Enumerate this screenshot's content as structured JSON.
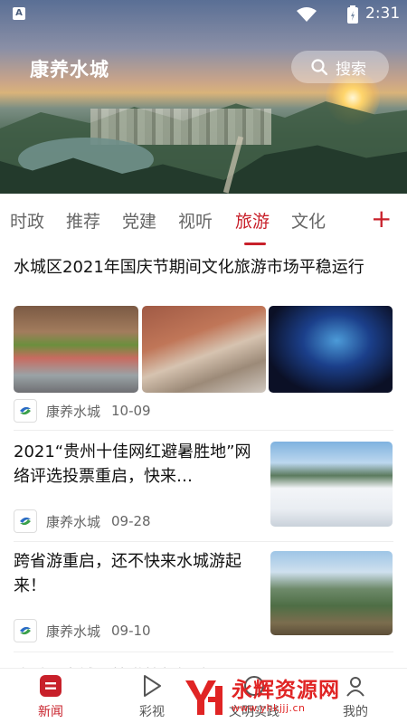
{
  "status_bar": {
    "time": "2:31",
    "left_icon": "A"
  },
  "header": {
    "app_title": "康养水城",
    "search_label": "搜索"
  },
  "tabs": [
    {
      "label": "时政",
      "active": false
    },
    {
      "label": "推荐",
      "active": false
    },
    {
      "label": "党建",
      "active": false
    },
    {
      "label": "视听",
      "active": false
    },
    {
      "label": "旅游",
      "active": true
    },
    {
      "label": "文化",
      "active": false
    }
  ],
  "add_tab_label": "+",
  "articles": [
    {
      "title": "水城区2021年国庆节期间文化旅游市场平稳运行",
      "source": "康养水城",
      "date": "10-09",
      "images": [
        "festival-performance",
        "ancient-stone-stairs",
        "cave-light-show"
      ]
    },
    {
      "title": "2021“贵州十佳网红避暑胜地”网络评选投票重启，快来…",
      "source": "康养水城",
      "date": "09-28",
      "images": [
        "ski-resort"
      ]
    },
    {
      "title": "跨省游重启，还不快来水城游起来！",
      "source": "康养水城",
      "date": "09-10",
      "images": [
        "canyon-valley"
      ]
    }
  ],
  "partial_next_title": "凉看…水城区特世教师招聘…",
  "bottom_nav": [
    {
      "label": "新闻",
      "icon": "news-icon",
      "active": true
    },
    {
      "label": "彩视",
      "icon": "play-icon",
      "active": false
    },
    {
      "label": "文明实践",
      "icon": "practice-icon",
      "active": false
    },
    {
      "label": "我的",
      "icon": "profile-icon",
      "active": false
    }
  ],
  "watermark": {
    "text": "永辉资源网",
    "url": "www.yhkjjj.cn"
  },
  "colors": {
    "accent": "#c8202a",
    "tab_inactive": "#666666"
  }
}
